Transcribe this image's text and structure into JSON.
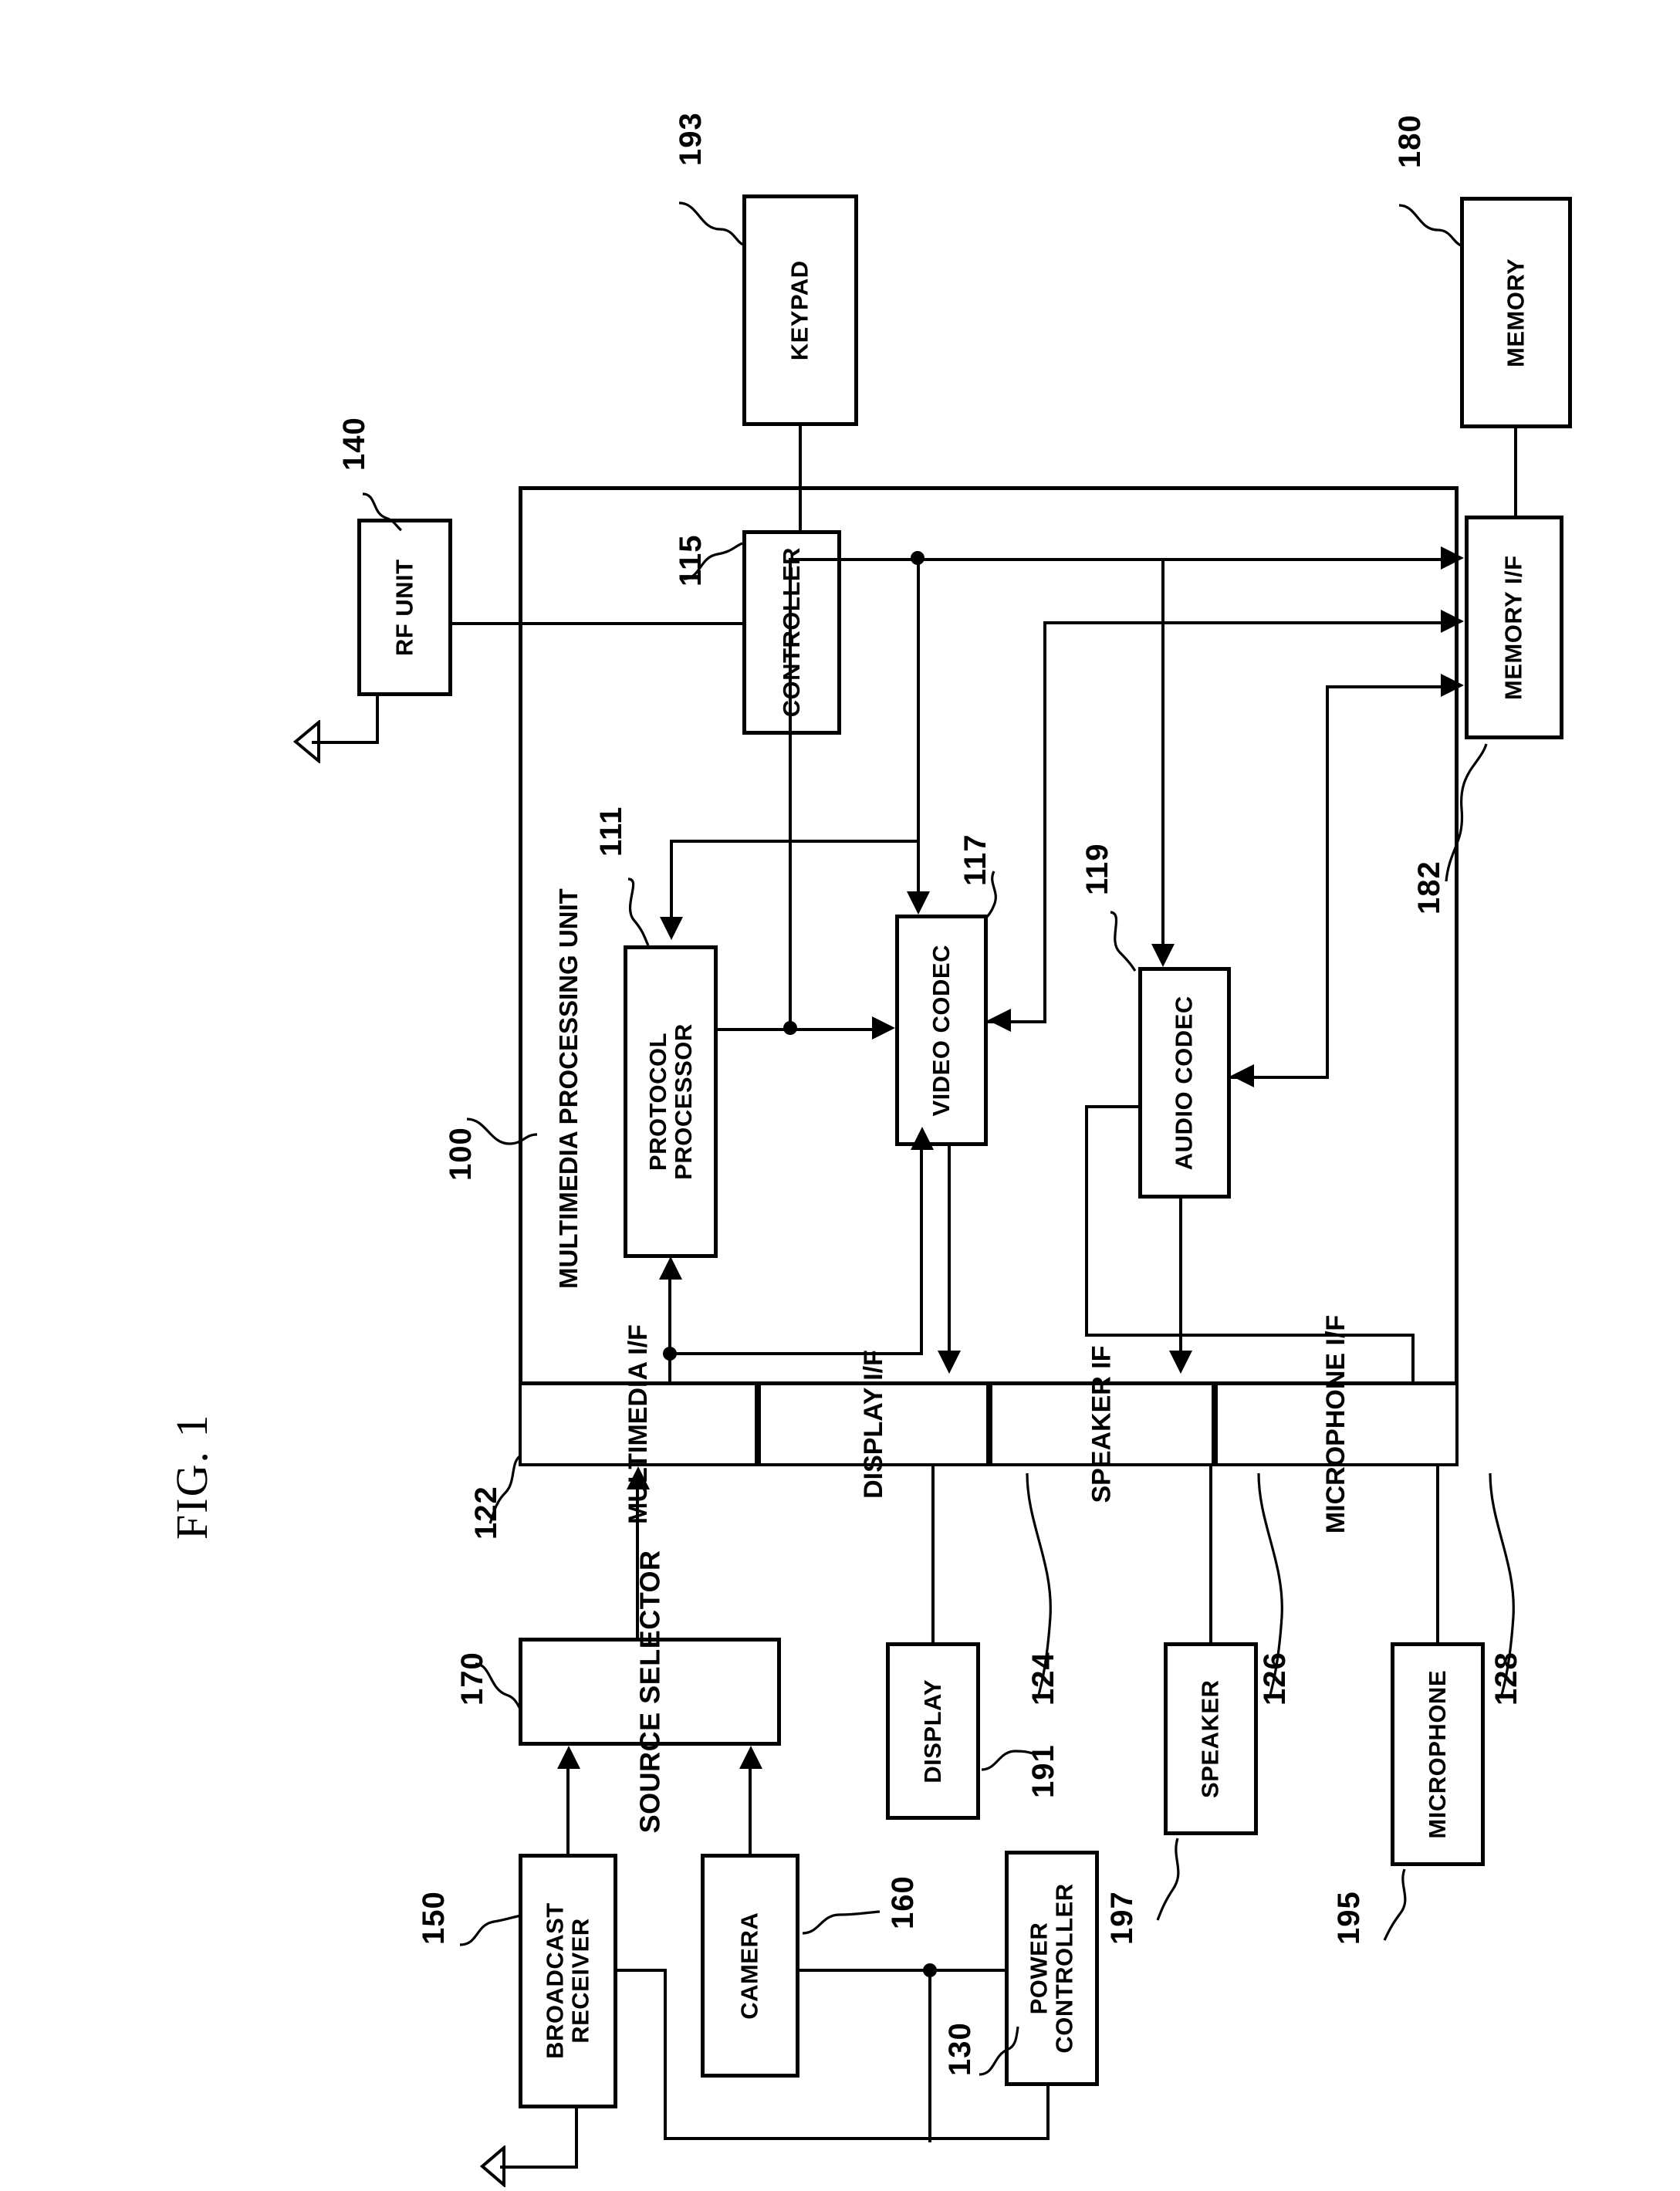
{
  "figure": {
    "title": "FIG. 1",
    "orientation": "landscape-rotated-90ccw"
  },
  "system": {
    "container_label": "MULTIMEDIA PROCESSING UNIT",
    "container_ref": "100"
  },
  "blocks": [
    {
      "id": "keypad",
      "label": "KEYPAD",
      "ref": "193"
    },
    {
      "id": "memory",
      "label": "MEMORY",
      "ref": "180"
    },
    {
      "id": "rf-unit",
      "label": "RF UNIT",
      "ref": "140"
    },
    {
      "id": "controller",
      "label": "CONTROLLER",
      "ref": "115"
    },
    {
      "id": "memory-if",
      "label": "MEMORY I/F",
      "ref": "182"
    },
    {
      "id": "protocol-processor",
      "label": "PROTOCOL PROCESSOR",
      "ref": "111"
    },
    {
      "id": "video-codec",
      "label": "VIDEO CODEC",
      "ref": "117"
    },
    {
      "id": "audio-codec",
      "label": "AUDIO CODEC",
      "ref": "119"
    },
    {
      "id": "multimedia-if",
      "label": "MULTIMEDIA I/F",
      "ref": "122"
    },
    {
      "id": "display-if",
      "label": "DISPLAY I/F",
      "ref": "124"
    },
    {
      "id": "speaker-if",
      "label": "SPEAKER IF",
      "ref": "126"
    },
    {
      "id": "microphone-if",
      "label": "MICROPHONE I/F",
      "ref": "128"
    },
    {
      "id": "source-selector",
      "label": "SOURCE SELECTOR",
      "ref": "170"
    },
    {
      "id": "display",
      "label": "DISPLAY",
      "ref": "191"
    },
    {
      "id": "speaker",
      "label": "SPEAKER",
      "ref": "197"
    },
    {
      "id": "microphone",
      "label": "MICROPHONE",
      "ref": "195"
    },
    {
      "id": "broadcast-receiver",
      "label": "BROADCAST RECEIVER",
      "ref": "150"
    },
    {
      "id": "camera",
      "label": "CAMERA",
      "ref": "160"
    },
    {
      "id": "power-controller",
      "label": "POWER CONTROLLER",
      "ref": "130"
    }
  ],
  "labels": {
    "keypad": "KEYPAD",
    "memory": "MEMORY",
    "rf_unit": "RF UNIT",
    "controller": "CONTROLLER",
    "memory_if": "MEMORY I/F",
    "protocol_processor_line1": "PROTOCOL",
    "protocol_processor_line2": "PROCESSOR",
    "video_codec": "VIDEO CODEC",
    "audio_codec": "AUDIO CODEC",
    "multimedia_if": "MULTIMEDIA I/F",
    "display_if": "DISPLAY I/F",
    "speaker_if": "SPEAKER IF",
    "microphone_if": "MICROPHONE I/F",
    "source_selector": "SOURCE SELECTOR",
    "display": "DISPLAY",
    "speaker": "SPEAKER",
    "microphone": "MICROPHONE",
    "broadcast_receiver_line1": "BROADCAST",
    "broadcast_receiver_line2": "RECEIVER",
    "camera": "CAMERA",
    "power_controller_line1": "POWER",
    "power_controller_line2": "CONTROLLER",
    "mpu": "MULTIMEDIA PROCESSING UNIT"
  },
  "refs": {
    "r100": "100",
    "r111": "111",
    "r115": "115",
    "r117": "117",
    "r119": "119",
    "r122": "122",
    "r124": "124",
    "r126": "126",
    "r128": "128",
    "r130": "130",
    "r140": "140",
    "r150": "150",
    "r160": "160",
    "r170": "170",
    "r180": "180",
    "r182": "182",
    "r191": "191",
    "r193": "193",
    "r195": "195",
    "r197": "197"
  },
  "style": {
    "ink": "#000000",
    "paper": "#ffffff"
  }
}
